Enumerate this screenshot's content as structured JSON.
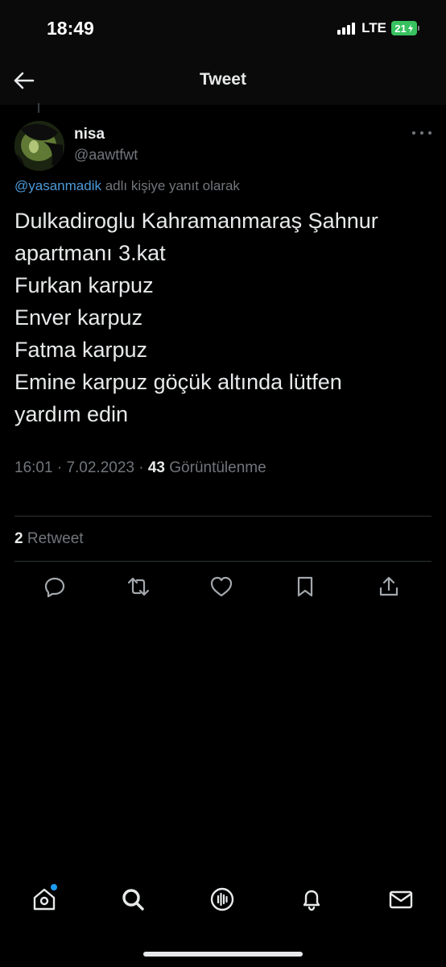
{
  "status_bar": {
    "time": "18:49",
    "network": "LTE",
    "battery": "21"
  },
  "header": {
    "title": "Tweet",
    "back_icon": "arrow-left-icon"
  },
  "tweet": {
    "author_name": "nisa",
    "author_handle": "@aawtfwt",
    "reply_to_mention": "@yasanmadik",
    "reply_to_suffix": " adlı kişiye yanıt olarak",
    "text_lines": [
      "Dulkadiroglu Kahramanmaraş Şahnur",
      "apartmanı 3.kat",
      "Furkan karpuz",
      "Enver karpuz",
      "Fatma karpuz",
      "Emine karpuz göçük altında lütfen",
      "yardım edin"
    ],
    "time": "16:01",
    "date": "7.02.2023",
    "separator": " · ",
    "view_count": "43",
    "view_label": " Görüntülenme"
  },
  "stats": {
    "retweet_count": "2",
    "retweet_label": " Retweet"
  },
  "actions": [
    "reply-icon",
    "retweet-icon",
    "like-icon",
    "bookmark-icon",
    "share-icon"
  ],
  "tabbar": [
    "home-icon",
    "search-icon",
    "spaces-icon",
    "notifications-icon",
    "messages-icon"
  ],
  "colors": {
    "background": "#000000",
    "text": "#e7e9ea",
    "secondary": "#71767b",
    "link": "#4d9ad9",
    "accent": "#1d9bf0",
    "battery": "#37c15f"
  }
}
